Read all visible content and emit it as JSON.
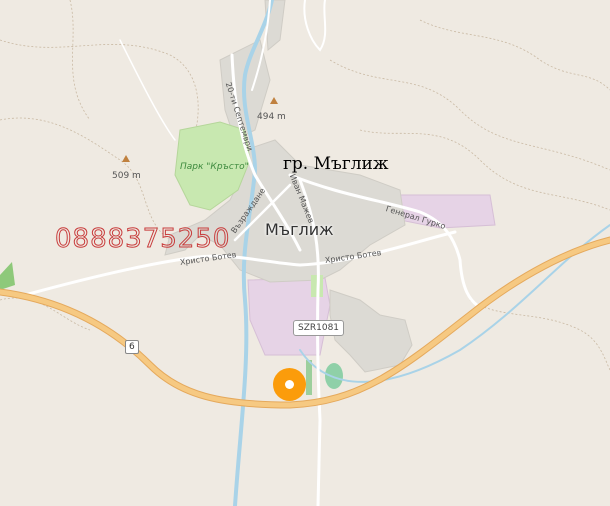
{
  "map": {
    "title": "гр. Мъглиж",
    "town_name": "Мъглиж",
    "phone_watermark": "0888375250",
    "park_label": "Парк \"Кръсто\"",
    "peaks": [
      {
        "elevation": "494 m"
      },
      {
        "elevation": "509 m"
      }
    ],
    "streets": {
      "hristo_botev_west": "Христо Ботев",
      "hristo_botev_east": "Христо Ботев",
      "general_gurko": "Генерал Гурко",
      "dvadeset_septemvri": "20-ти Септември",
      "vazrazhdane": "Възраждане",
      "ivan_mazhev": "Иван Мажев"
    },
    "route_badge": "SZR1081",
    "road_shield": "6",
    "colors": {
      "land": "#efeae2",
      "residential": "#dcdad4",
      "industrial": "#e6d3e6",
      "park": "#c8e8b0",
      "water": "#a9d3e8",
      "trunk_road": "#f6c982",
      "marker": "#fb9c0b",
      "watermark": "#c83c3c"
    }
  }
}
